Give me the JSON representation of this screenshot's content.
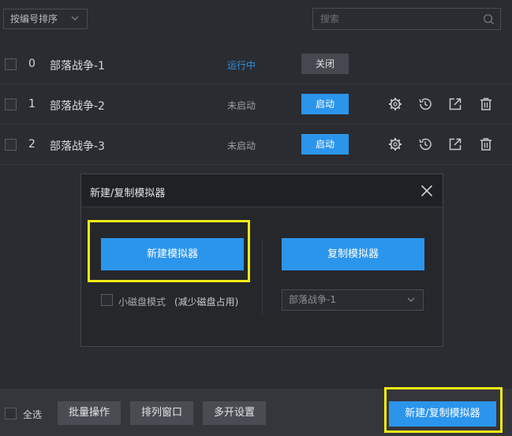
{
  "topbar": {
    "sort_label": "按编号排序",
    "search_placeholder": "搜索"
  },
  "instances": [
    {
      "index": "0",
      "name": "部落战争-1",
      "status": "运行中",
      "action": "关闭"
    },
    {
      "index": "1",
      "name": "部落战争-2",
      "status": "未启动",
      "action": "启动"
    },
    {
      "index": "2",
      "name": "部落战争-3",
      "status": "未启动",
      "action": "启动"
    }
  ],
  "dialog": {
    "title": "新建/复制模拟器",
    "new_button": "新建模拟器",
    "copy_button": "复制模拟器",
    "small_disk_label": "小磁盘模式",
    "small_disk_note": "(减少磁盘占用)",
    "copy_source": "部落战争-1"
  },
  "bottombar": {
    "select_all": "全选",
    "batch_ops": "批量操作",
    "arrange_windows": "排列窗口",
    "multi_settings": "多开设置",
    "create_copy": "新建/复制模拟器"
  },
  "colors": {
    "accent": "#2b95ec",
    "highlight": "#f3ec13",
    "running": "#2e93e6"
  }
}
